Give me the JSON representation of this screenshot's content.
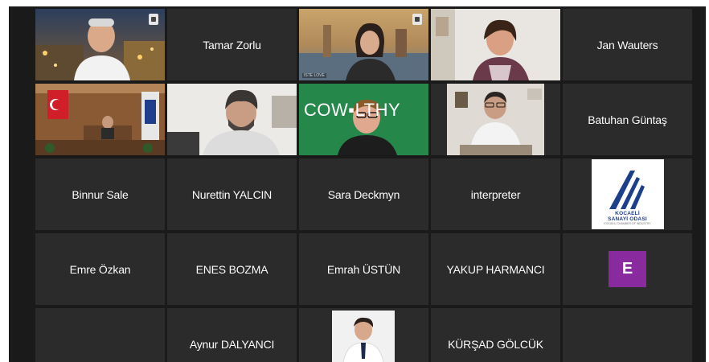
{
  "window": {
    "background": "#1a1a1a",
    "tile_color": "#2b2b2b",
    "active_speaker_color": "#c8d649"
  },
  "tiles": {
    "r1c1": {
      "kind": "video",
      "desc_icon": "pin-icon"
    },
    "r1c2": {
      "kind": "name",
      "name": "Tamar Zorlu"
    },
    "r1c3": {
      "kind": "video",
      "overlay": "ISTE LOVE"
    },
    "r1c4": {
      "kind": "video"
    },
    "r1c5": {
      "kind": "name",
      "name": "Jan Wauters"
    },
    "r2c1": {
      "kind": "video"
    },
    "r2c2": {
      "kind": "video"
    },
    "r2c3": {
      "kind": "video",
      "banner": "COW▪LTHY"
    },
    "r2c4": {
      "kind": "video"
    },
    "r2c5": {
      "kind": "name",
      "name": "Batuhan Güntaş"
    },
    "r3c1": {
      "kind": "name",
      "name": "Binnur Sale"
    },
    "r3c2": {
      "kind": "name",
      "name": "Nurettin YALCIN"
    },
    "r3c3": {
      "kind": "name",
      "name": "Sara Deckmyn"
    },
    "r3c4": {
      "kind": "name",
      "name": "interpreter"
    },
    "r3c5": {
      "kind": "logo",
      "logo_line1": "KOCAELİ",
      "logo_line2": "SANAYİ ODASI",
      "logo_line3": "KOCAELI CHAMBER OF INDUSTRY"
    },
    "r4c1": {
      "kind": "name",
      "name": "Emre Özkan"
    },
    "r4c2": {
      "kind": "name",
      "name": "ENES BOZMA"
    },
    "r4c3": {
      "kind": "name",
      "name": "Emrah ÜSTÜN"
    },
    "r4c4": {
      "kind": "name",
      "name": "YAKUP HARMANCI"
    },
    "r4c5": {
      "kind": "avatar",
      "initial": "E",
      "color": "#8a2a9f"
    },
    "r5c2": {
      "kind": "name",
      "name": "Aynur DALYANCI"
    },
    "r5c3": {
      "kind": "video"
    },
    "r5c4": {
      "kind": "name",
      "name": "KÜRŞAD GÖLCÜK"
    }
  }
}
